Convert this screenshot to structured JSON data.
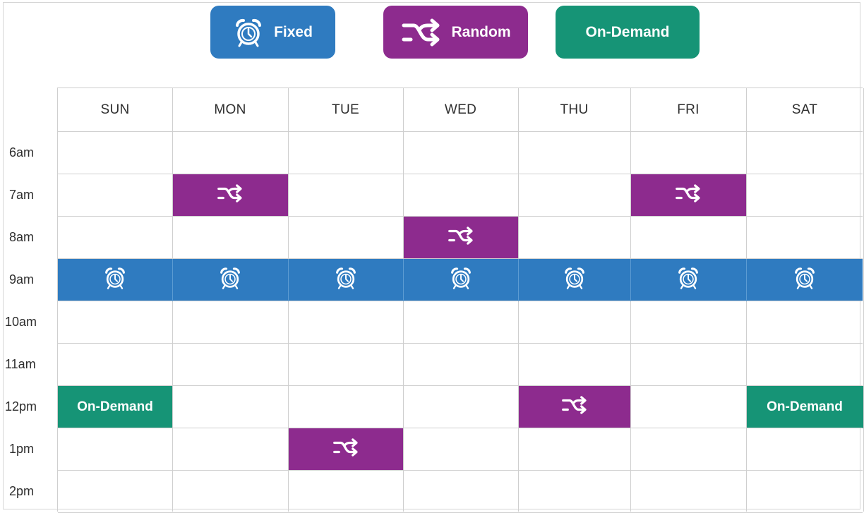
{
  "legend": {
    "fixed": {
      "label": "Fixed",
      "color": "#2f7bc0",
      "icon": "alarm-clock-icon"
    },
    "random": {
      "label": "Random",
      "color": "#8d2b8e",
      "icon": "shuffle-icon"
    },
    "on_demand": {
      "label": "On-Demand",
      "color": "#169476"
    }
  },
  "schedule": {
    "days": [
      "SUN",
      "MON",
      "TUE",
      "WED",
      "THU",
      "FRI",
      "SAT"
    ],
    "times": [
      "6am",
      "7am",
      "8am",
      "9am",
      "10am",
      "11am",
      "12pm",
      "1pm",
      "2pm"
    ],
    "events": [
      {
        "type": "random",
        "day": "MON",
        "time": "7am"
      },
      {
        "type": "random",
        "day": "FRI",
        "time": "7am"
      },
      {
        "type": "random",
        "day": "WED",
        "time": "8am"
      },
      {
        "type": "fixed",
        "day": "SUN",
        "time": "9am"
      },
      {
        "type": "fixed",
        "day": "MON",
        "time": "9am"
      },
      {
        "type": "fixed",
        "day": "TUE",
        "time": "9am"
      },
      {
        "type": "fixed",
        "day": "WED",
        "time": "9am"
      },
      {
        "type": "fixed",
        "day": "THU",
        "time": "9am"
      },
      {
        "type": "fixed",
        "day": "FRI",
        "time": "9am"
      },
      {
        "type": "fixed",
        "day": "SAT",
        "time": "9am"
      },
      {
        "type": "on_demand",
        "day": "SUN",
        "time": "12pm",
        "label": "On-Demand"
      },
      {
        "type": "random",
        "day": "THU",
        "time": "12pm"
      },
      {
        "type": "on_demand",
        "day": "SAT",
        "time": "12pm",
        "label": "On-Demand"
      },
      {
        "type": "random",
        "day": "TUE",
        "time": "1pm"
      }
    ]
  }
}
